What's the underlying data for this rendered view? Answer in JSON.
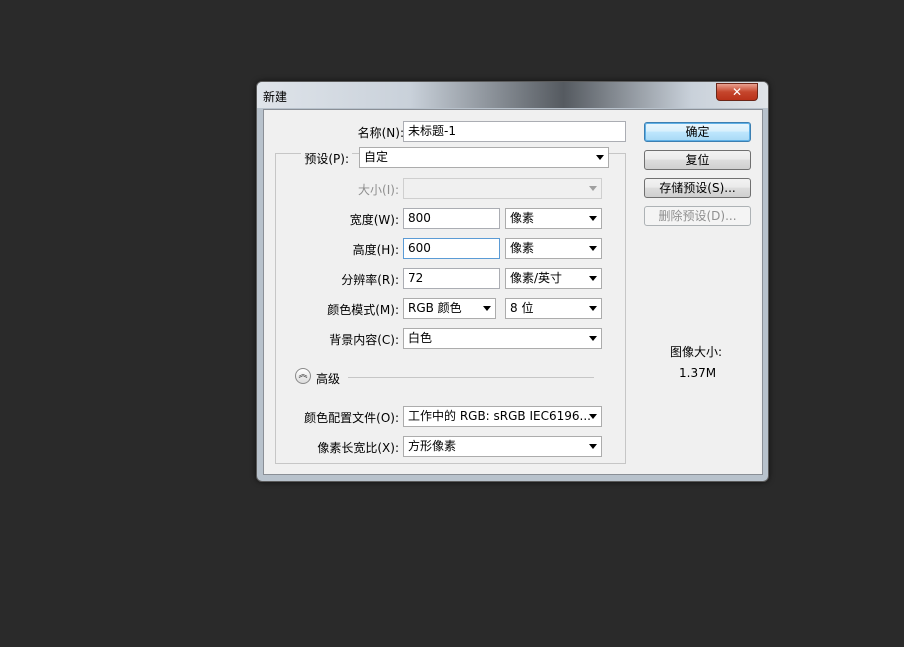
{
  "window": {
    "title": "新建",
    "close_label": "✕"
  },
  "form": {
    "name_label": "名称(N):",
    "name_value": "未标题-1",
    "preset_label": "预设(P):",
    "preset_value": "自定",
    "size_label": "大小(I):",
    "size_value": "",
    "width_label": "宽度(W):",
    "width_value": "800",
    "width_unit": "像素",
    "height_label": "高度(H):",
    "height_value": "600",
    "height_unit": "像素",
    "resolution_label": "分辨率(R):",
    "resolution_value": "72",
    "resolution_unit": "像素/英寸",
    "color_mode_label": "颜色模式(M):",
    "color_mode_value": "RGB 颜色",
    "bit_depth_value": "8 位",
    "background_label": "背景内容(C):",
    "background_value": "白色",
    "advanced_label": "高级",
    "profile_label": "颜色配置文件(O):",
    "profile_value": "工作中的 RGB: sRGB IEC6196...",
    "aspect_label": "像素长宽比(X):",
    "aspect_value": "方形像素"
  },
  "buttons": {
    "ok": "确定",
    "reset": "复位",
    "save_preset": "存储预设(S)...",
    "delete_preset": "删除预设(D)..."
  },
  "image_size": {
    "label": "图像大小:",
    "value": "1.37M"
  }
}
